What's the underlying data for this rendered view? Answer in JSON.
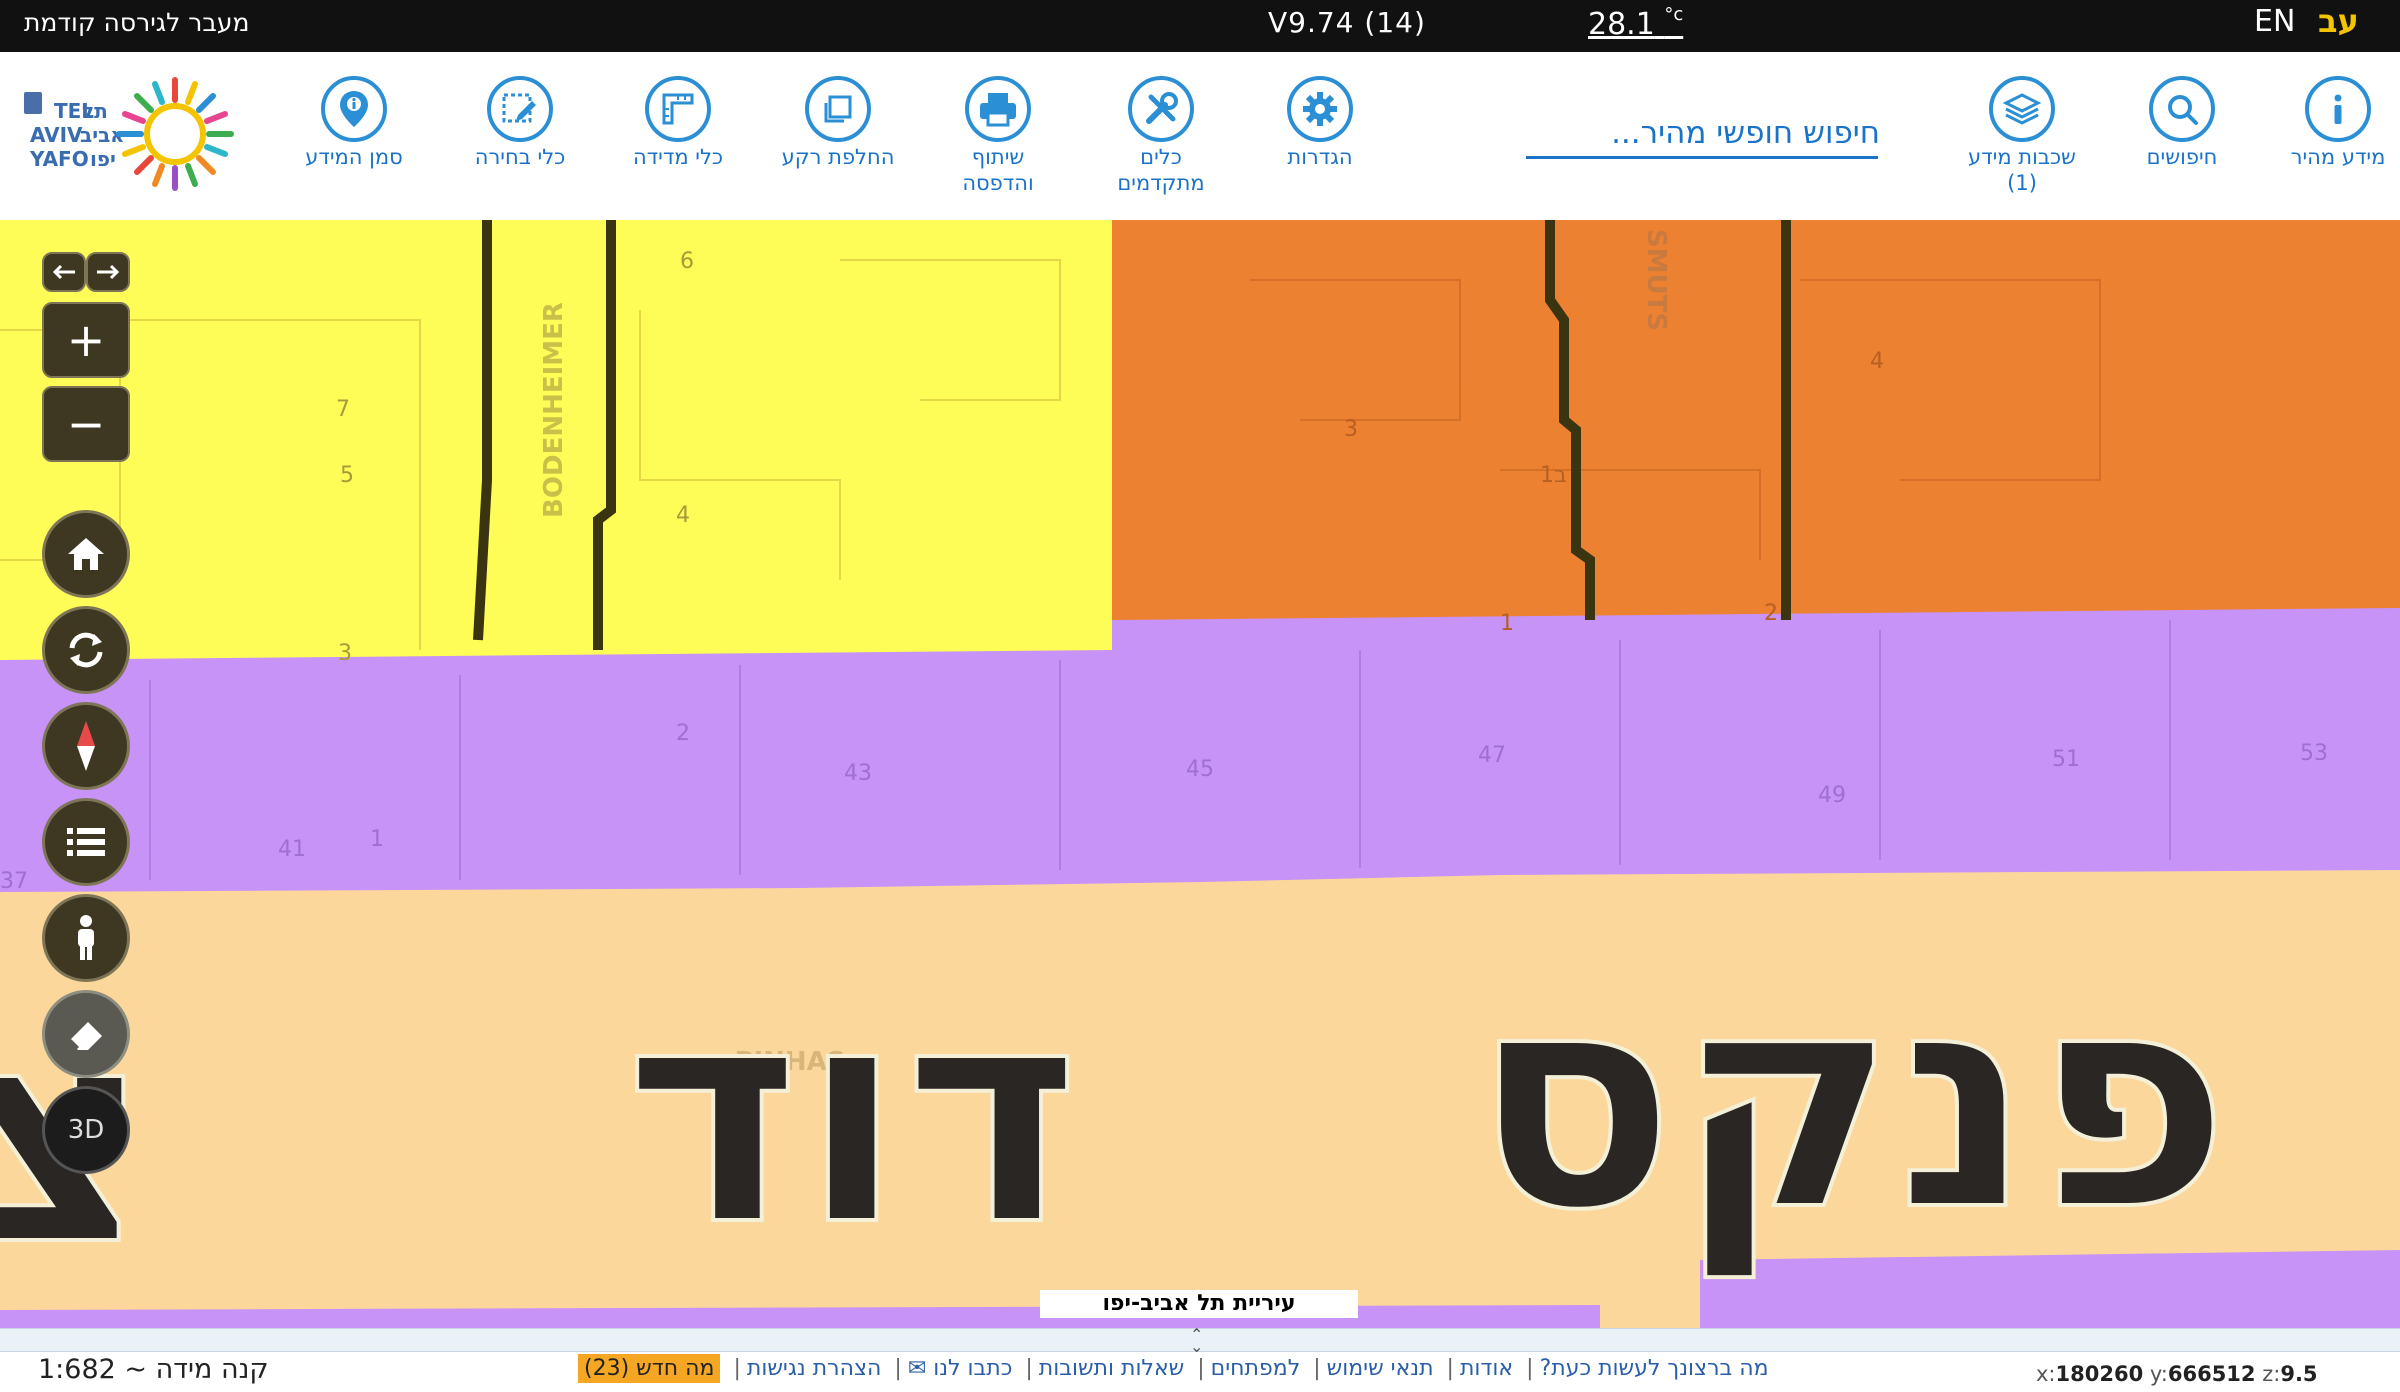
{
  "topbar": {
    "prev_version_link": "מעבר לגירסה קודמת",
    "version": "V9.74 (14)",
    "temperature": "28.1",
    "temp_unit": "°c",
    "lang_en": "EN",
    "lang_he": "עב"
  },
  "logo": {
    "text_lines": [
      "תל",
      "אביב",
      "TEL",
      "AVIV",
      "YAFO",
      "יפו"
    ]
  },
  "toolbar": {
    "quick_info": "מידע מהיר",
    "searches": "חיפושים",
    "layers_line1": "שכבות מידע",
    "layers_count": "(1)",
    "search_placeholder": "חיפוש חופשי מהיר...",
    "settings": "הגדרות",
    "advanced_tools_line1": "כלים",
    "advanced_tools_line2": "מתקדמים",
    "share_line1": "שיתוף",
    "share_line2": "והדפסה",
    "basemap": "החלפת רקע",
    "measure": "כלי מדידה",
    "select": "כלי בחירה",
    "marker": "סמן המידע"
  },
  "map": {
    "street_labels": [
      "BODENHEIMER",
      "SMUTS",
      "PINHAS",
      "פנקס",
      "דוד",
      "צ"
    ],
    "parcel_numbers": [
      "6",
      "7",
      "5",
      "4",
      "3",
      "3",
      "1",
      "2",
      "4",
      "1",
      "2",
      "2",
      "43",
      "45",
      "47",
      "49",
      "51",
      "53",
      "41",
      "1",
      "37",
      "1ב"
    ],
    "controls": {
      "zoom_in": "+",
      "zoom_out": "−",
      "mode_3d": "3D"
    },
    "attribution": "עיריית תל אביב-יפו",
    "colors": {
      "residential": "#fefd58",
      "commercial": "#ed8132",
      "road": "#c793f7",
      "public": "#fcd79c"
    }
  },
  "footer": {
    "scale_label": "קנה מידה ~ 1:682",
    "links": [
      "מה ברצונך לעשות כעת?",
      "אודות",
      "תנאי שימוש",
      "למפתחים",
      "שאלות ותשובות",
      "כתבו לנו ✉",
      "הצהרת נגישות"
    ],
    "whats_new": "מה חדש (23)",
    "coords": {
      "x_label": "x:",
      "x": "180260",
      "y_label": "y:",
      "y": "666512",
      "z_label": "z:",
      "z": "9.5"
    }
  }
}
